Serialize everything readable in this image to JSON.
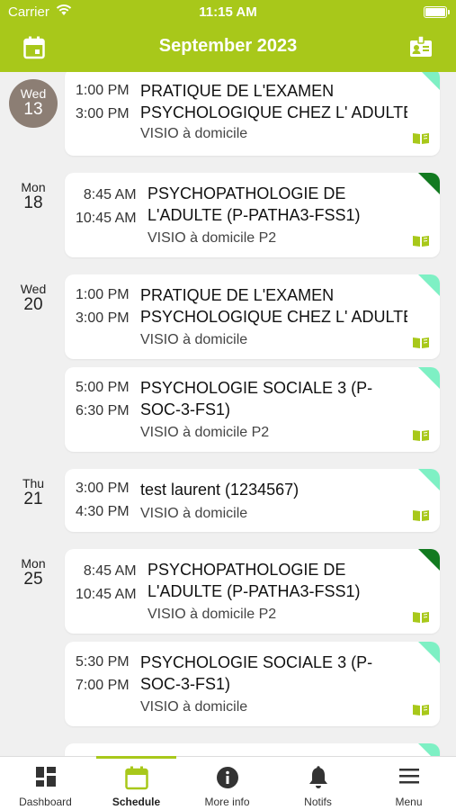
{
  "status": {
    "carrier": "Carrier",
    "time": "11:15 AM"
  },
  "header": {
    "title": "September 2023"
  },
  "colors": {
    "brand": "#a8c81a",
    "today_badge": "#8c7e74",
    "corner_light": "#7ef0c4",
    "corner_dark": "#127a20"
  },
  "days": [
    {
      "dow": "Wed",
      "num": "13"
    },
    {
      "dow": "Mon",
      "num": "18"
    },
    {
      "dow": "Wed",
      "num": "20"
    },
    {
      "dow": "Thu",
      "num": "21"
    },
    {
      "dow": "Mon",
      "num": "25"
    }
  ],
  "events": [
    {
      "start": "1:00 PM",
      "end": "3:00 PM",
      "line1": "PRATIQUE DE L'EXAMEN",
      "line2": "PSYCHOLOGIQUE CHEZ L' ADULTE",
      "location": "VISIO à domicile"
    },
    {
      "start": "8:45 AM",
      "end": "10:45 AM",
      "line1": "PSYCHOPATHOLOGIE DE",
      "line2": "L'ADULTE  (P-PATHA3-FSS1)",
      "location": "VISIO à domicile P2"
    },
    {
      "start": "1:00 PM",
      "end": "3:00 PM",
      "line1": "PRATIQUE DE L'EXAMEN",
      "line2": "PSYCHOLOGIQUE CHEZ L' ADULTE",
      "location": "VISIO à domicile"
    },
    {
      "start": "5:00 PM",
      "end": "6:30 PM",
      "line1": "PSYCHOLOGIE SOCIALE 3 (P-",
      "line2": "SOC-3-FS1)",
      "location": "VISIO à domicile P2"
    },
    {
      "start": "3:00 PM",
      "end": "4:30 PM",
      "line1": "test laurent  (1234567)",
      "location": "VISIO à domicile"
    },
    {
      "start": "8:45 AM",
      "end": "10:45 AM",
      "line1": "PSYCHOPATHOLOGIE DE",
      "line2": "L'ADULTE  (P-PATHA3-FSS1)",
      "location": "VISIO à domicile P2"
    },
    {
      "start": "5:30 PM",
      "end": "7:00 PM",
      "line1": "PSYCHOLOGIE SOCIALE 3 (P-",
      "line2": "SOC-3-FS1)",
      "location": "VISIO à domicile"
    }
  ],
  "tabs": [
    {
      "label": "Dashboard",
      "icon": "dashboard-icon"
    },
    {
      "label": "Schedule",
      "icon": "calendar-icon"
    },
    {
      "label": "More info",
      "icon": "info-icon"
    },
    {
      "label": "Notifs",
      "icon": "bell-icon"
    },
    {
      "label": "Menu",
      "icon": "hamburger-icon"
    }
  ]
}
